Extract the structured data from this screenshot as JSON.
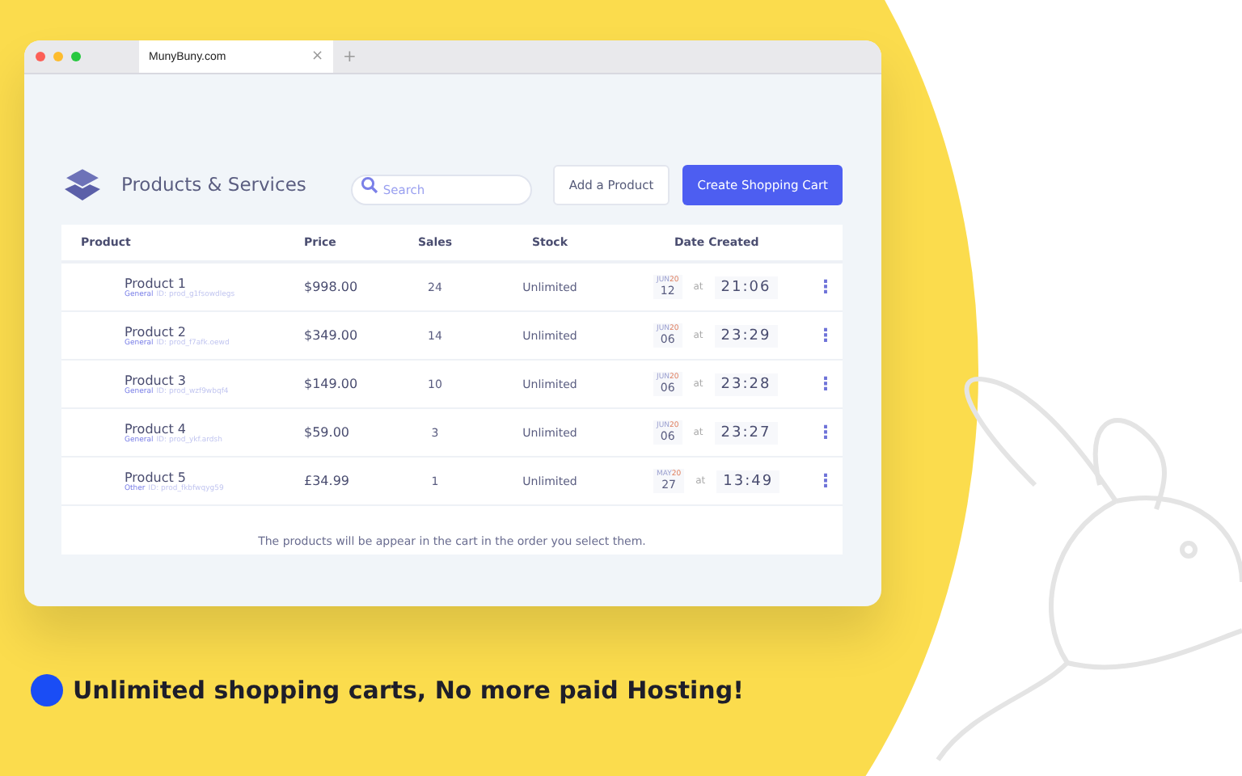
{
  "browser": {
    "tab_title": "MunyBuny.com",
    "close_tab": "×",
    "new_tab": "+"
  },
  "header": {
    "title": "Products & Services",
    "search": {
      "placeholder": "Search"
    },
    "buttons": [
      {
        "label": "Add a Product",
        "kind": "secondary"
      },
      {
        "label": "Create Shopping Cart",
        "kind": "primary"
      }
    ]
  },
  "table": {
    "columns": [
      "Product",
      "Price",
      "Sales",
      "Stock",
      "Date Created"
    ],
    "rows": [
      {
        "name": "Product 1",
        "category": "General",
        "id": "ID: prod_g1fsowdlegs",
        "price": "$998.00",
        "sales": "24",
        "stock": "Unlimited",
        "month": "JUN",
        "year": "20",
        "day": "12",
        "at": "at",
        "time": "21:06",
        "menu": "⋮"
      },
      {
        "name": "Product 2",
        "category": "General",
        "id": "ID: prod_f7afk.oewd",
        "price": "$349.00",
        "sales": "14",
        "stock": "Unlimited",
        "month": "JUN",
        "year": "20",
        "day": "06",
        "at": "at",
        "time": "23:29",
        "menu": "⋮"
      },
      {
        "name": "Product 3",
        "category": "General",
        "id": "ID: prod_wzf9wbqf4",
        "price": "$149.00",
        "sales": "10",
        "stock": "Unlimited",
        "month": "JUN",
        "year": "20",
        "day": "06",
        "at": "at",
        "time": "23:28",
        "menu": "⋮"
      },
      {
        "name": "Product 4",
        "category": "General",
        "id": "ID: prod_ykf.ardsh",
        "price": "$59.00",
        "sales": "3",
        "stock": "Unlimited",
        "month": "JUN",
        "year": "20",
        "day": "06",
        "at": "at",
        "time": "23:27",
        "menu": "⋮"
      },
      {
        "name": "Product 5",
        "category": "Other",
        "id": "ID: prod_fkbfwqyg59",
        "price": "£34.99",
        "sales": "1",
        "stock": "Unlimited",
        "month": "MAY",
        "year": "20",
        "day": "27",
        "at": "at",
        "time": "13:49",
        "menu": "⋮"
      }
    ],
    "footer": "The products will be appear in the cart in the order you select them."
  },
  "caption": {
    "text": "Unlimited shopping carts, No more paid Hosting!",
    "color": "#1a4df5"
  }
}
